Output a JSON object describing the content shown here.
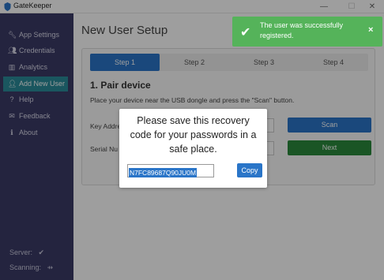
{
  "window": {
    "title": "GateKeeper",
    "minimize_icon": "minimize-icon",
    "maximize_icon": "maximize-icon",
    "close_icon": "close-icon"
  },
  "sidebar": {
    "items": [
      {
        "label": "App Settings",
        "icon": "wrench-icon"
      },
      {
        "label": "Credentials",
        "icon": "users-icon"
      },
      {
        "label": "Analytics",
        "icon": "bar-chart-icon"
      },
      {
        "label": "Add New User",
        "icon": "add-user-icon",
        "active": true
      },
      {
        "label": "Help",
        "icon": "question-icon"
      },
      {
        "label": "Feedback",
        "icon": "envelope-icon"
      },
      {
        "label": "About",
        "icon": "info-icon"
      }
    ],
    "server_label": "Server:",
    "scanning_label": "Scanning:"
  },
  "main": {
    "title": "New User Setup",
    "steps": [
      "Step 1",
      "Step 2",
      "Step 3",
      "Step 4"
    ],
    "active_step": 0,
    "section_title": "1. Pair device",
    "instructions": "Place your device near the USB dongle and press the \"Scan\" button.",
    "key_label": "Key Addre",
    "serial_label": "Serial Nu",
    "scan_label": "Scan",
    "next_label": "Next"
  },
  "toast": {
    "message": "The user was successfully registered.",
    "close_label": "×"
  },
  "modal": {
    "message": "Please save this recovery code for your passwords in a safe place.",
    "code": "N7FC89687Q90JU0M",
    "copy_label": "Copy"
  },
  "colors": {
    "sidebar_bg": "#3a3a66",
    "accent_teal": "#2a8c99",
    "primary_blue": "#2a75c8",
    "success_green": "#2a8a3c",
    "toast_green": "#55b35a"
  }
}
